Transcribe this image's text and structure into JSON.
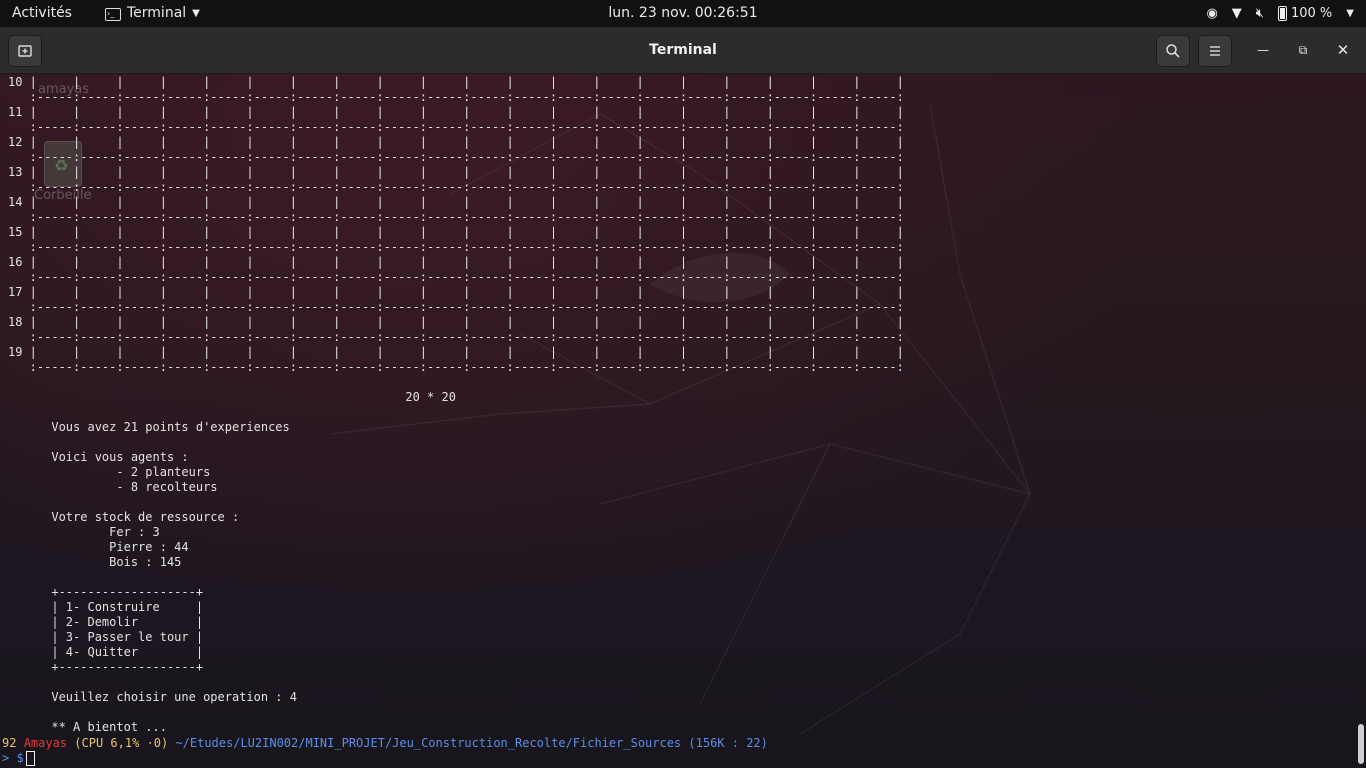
{
  "topbar": {
    "activities": "Activités",
    "app_name": "Terminal",
    "clock": "lun. 23 nov.  00:26:51",
    "battery": "100 %"
  },
  "window": {
    "title": "Terminal"
  },
  "desktop": {
    "user_label": "amayas",
    "trash_label": "Corbeille"
  },
  "board": {
    "rows": [
      "10",
      "11",
      "12",
      "13",
      "14",
      "15",
      "16",
      "17",
      "18",
      "19"
    ],
    "columns": 20,
    "size_label": "20 * 20"
  },
  "game": {
    "experience": "Vous avez 21 points d'experiences",
    "agents_title": "Voici vous agents :",
    "agents": [
      "- 2 planteurs",
      "- 8 recolteurs"
    ],
    "stock_title": "Votre stock de ressource :",
    "stock": [
      "Fer : 3",
      "Pierre : 44",
      "Bois : 145"
    ],
    "menu": [
      "1- Construire",
      "2- Demolir",
      "3- Passer le tour",
      "4- Quitter"
    ],
    "choice": "Veuillez choisir une operation : 4",
    "goodbye": "** A bientot ..."
  },
  "prompt": {
    "number": "92",
    "user": "Amayas",
    "cpu": "(CPU 6,1% ⋅0)",
    "path": "~/Etudes/LU2IN002/MINI_PROJET/Jeu_Construction_Recolte/Fichier_Sources",
    "size_info": "(156K : 22)",
    "input_prefix": "> $"
  },
  "colors": {
    "prompt_user": "#e23a3a",
    "prompt_path": "#5b8ee6",
    "prompt_accent": "#e9c46a"
  }
}
